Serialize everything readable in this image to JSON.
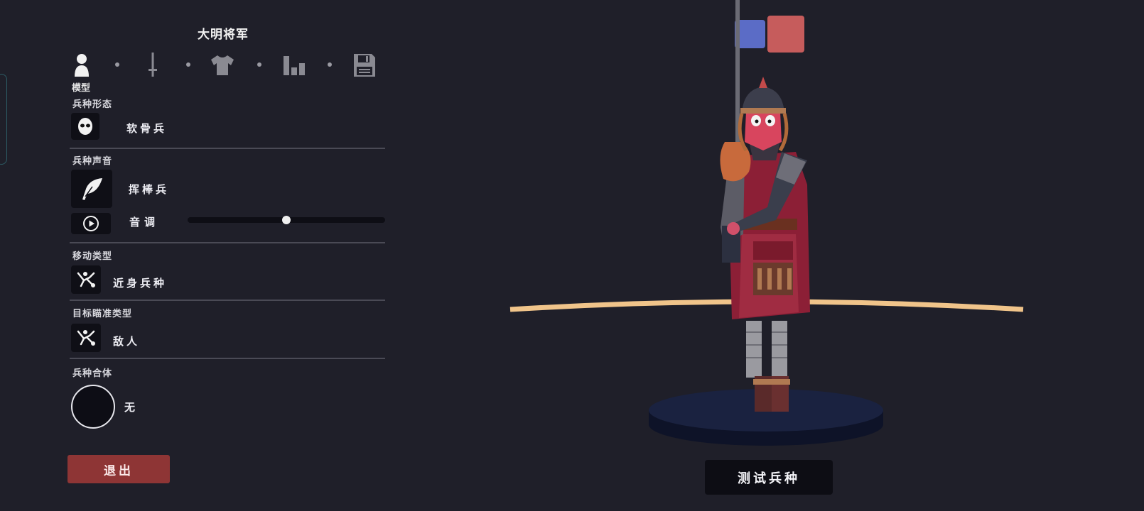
{
  "panel": {
    "title": "大明将军",
    "tabs": [
      {
        "name": "model",
        "icon": "person-icon",
        "active": true
      },
      {
        "name": "weapon",
        "icon": "sword-icon",
        "active": false
      },
      {
        "name": "clothing",
        "icon": "shirt-icon",
        "active": false
      },
      {
        "name": "stats",
        "icon": "bar-chart-icon",
        "active": false
      },
      {
        "name": "save",
        "icon": "floppy-disk-icon",
        "active": false
      }
    ],
    "active_tab_label": "模型",
    "sections": {
      "form": {
        "title": "兵种形态",
        "value": "软骨兵",
        "icon": "mask-face-icon"
      },
      "voice": {
        "title": "兵种声音",
        "value": "挥棒兵",
        "icon": "feather-icon",
        "pitch_label": "音调",
        "pitch_level": 0.5,
        "play_icon": "play-icon"
      },
      "movement": {
        "title": "移动类型",
        "value": "近身兵种",
        "icon": "melee-unit-icon"
      },
      "target": {
        "title": "目标瞄准类型",
        "value": "敌人",
        "icon": "target-unit-icon"
      },
      "combine": {
        "title": "兵种合体",
        "value": "无"
      }
    },
    "exit_label": "退出"
  },
  "scene": {
    "test_button_label": "测试兵种",
    "team_colors": {
      "blue": "#5b6cc6",
      "red": "#c65c5c"
    }
  },
  "colors": {
    "background": "#1f1f29",
    "exit_button": "#8e3535",
    "ground_ring": "#f0c48a",
    "pedestal": "#141a2e"
  }
}
